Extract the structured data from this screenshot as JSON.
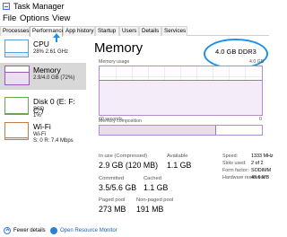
{
  "window": {
    "title": "Task Manager"
  },
  "menu": {
    "items": [
      "File",
      "Options",
      "View"
    ]
  },
  "tabs": [
    "Processes",
    "Performance",
    "App history",
    "Startup",
    "Users",
    "Details",
    "Services"
  ],
  "active_tab": "Performance",
  "sidebar": {
    "items": [
      {
        "name": "CPU",
        "sub": "28% 2.61 GHz",
        "level": 0.28,
        "color": "#5aa0dc"
      },
      {
        "name": "Memory",
        "sub": "2.9/4.0 GB (72%)",
        "level": 0.72,
        "color": "#9b59b6"
      },
      {
        "name": "Disk 0 (E: F: C:)",
        "sub1": "SSD",
        "sub2": "1%",
        "level": 0.01,
        "color": "#68a84f"
      },
      {
        "name": "Wi-Fi",
        "sub1": "Wi-Fi",
        "sub2": "S: 0 R: 7.4 Mbps",
        "level": 0.1,
        "color": "#c77b3e"
      }
    ]
  },
  "memory": {
    "title": "Memory",
    "capacity": "4.0 GB DDR3",
    "usage_label": "Memory usage",
    "usage_max": "4.0 GB",
    "axis_left": "60 seconds",
    "axis_right": "0",
    "usage_fraction": 0.72,
    "composition_label": "Memory composition",
    "composition_in_use": 0.72
  },
  "stats": {
    "in_use_label": "In use (Compressed)",
    "in_use_value": "2.9 GB (120 MB)",
    "available_label": "Available",
    "available_value": "1.1 GB",
    "committed_label": "Committed",
    "committed_value": "3.5/5.6 GB",
    "cached_label": "Cached",
    "cached_value": "1.1 GB",
    "paged_pool_label": "Paged pool",
    "paged_pool_value": "273 MB",
    "non_paged_pool_label": "Non-paged pool",
    "non_paged_pool_value": "191 MB"
  },
  "specs": [
    {
      "label": "Speed:",
      "value": "1333 MHz"
    },
    {
      "label": "Slots used:",
      "value": "2 of 2"
    },
    {
      "label": "Form factor:",
      "value": "SODIMM"
    },
    {
      "label": "Hardware reserved:",
      "value": "49.6 MB"
    }
  ],
  "footer": {
    "fewer_details": "Fewer details",
    "open_resource_monitor": "Open Resource Monitor"
  },
  "colors": {
    "accent": "#1e90e6",
    "memory": "#9b59b6",
    "link": "#1a5fb4"
  }
}
